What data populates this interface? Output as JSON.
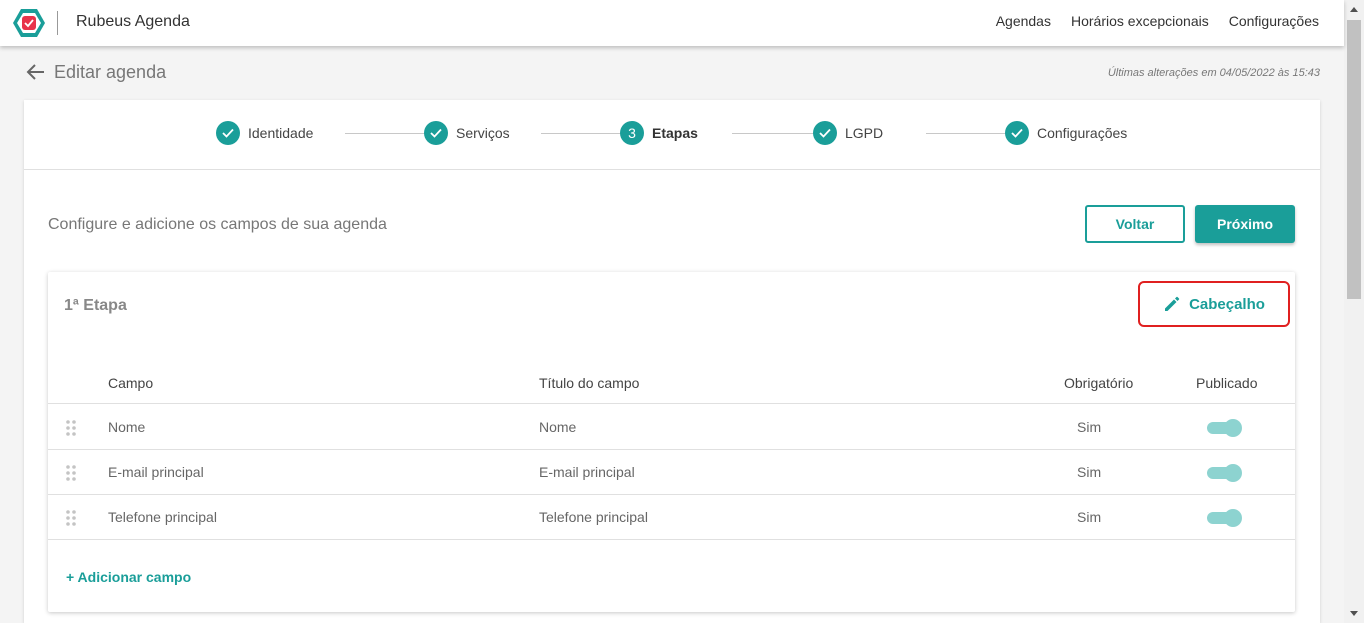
{
  "app": {
    "title": "Rubeus Agenda",
    "brand_color": "#1a9e99",
    "logo_color": "#e8334a"
  },
  "topnav": {
    "items": [
      "Agendas",
      "Horários excepcionais",
      "Configurações"
    ]
  },
  "page": {
    "title": "Editar agenda",
    "last_change": "Últimas alterações em 04/05/2022 às 15:43"
  },
  "stepper": {
    "steps": [
      {
        "label": "Identidade",
        "state": "done"
      },
      {
        "label": "Serviços",
        "state": "done"
      },
      {
        "label": "Etapas",
        "state": "current",
        "number": "3"
      },
      {
        "label": "LGPD",
        "state": "done"
      },
      {
        "label": "Configurações",
        "state": "done"
      }
    ]
  },
  "content": {
    "instructions": "Configure e adicione os campos de sua agenda",
    "back_label": "Voltar",
    "next_label": "Próximo"
  },
  "stage": {
    "title": "1ª Etapa",
    "header_button": "Cabeçalho",
    "columns": {
      "field": "Campo",
      "field_title": "Título do campo",
      "required": "Obrigatório",
      "published": "Publicado"
    },
    "rows": [
      {
        "field": "Nome",
        "field_title": "Nome",
        "required": "Sim",
        "published": true
      },
      {
        "field": "E-mail principal",
        "field_title": "E-mail principal",
        "required": "Sim",
        "published": true
      },
      {
        "field": "Telefone principal",
        "field_title": "Telefone principal",
        "required": "Sim",
        "published": true
      }
    ],
    "add_field": "+ Adicionar campo"
  }
}
